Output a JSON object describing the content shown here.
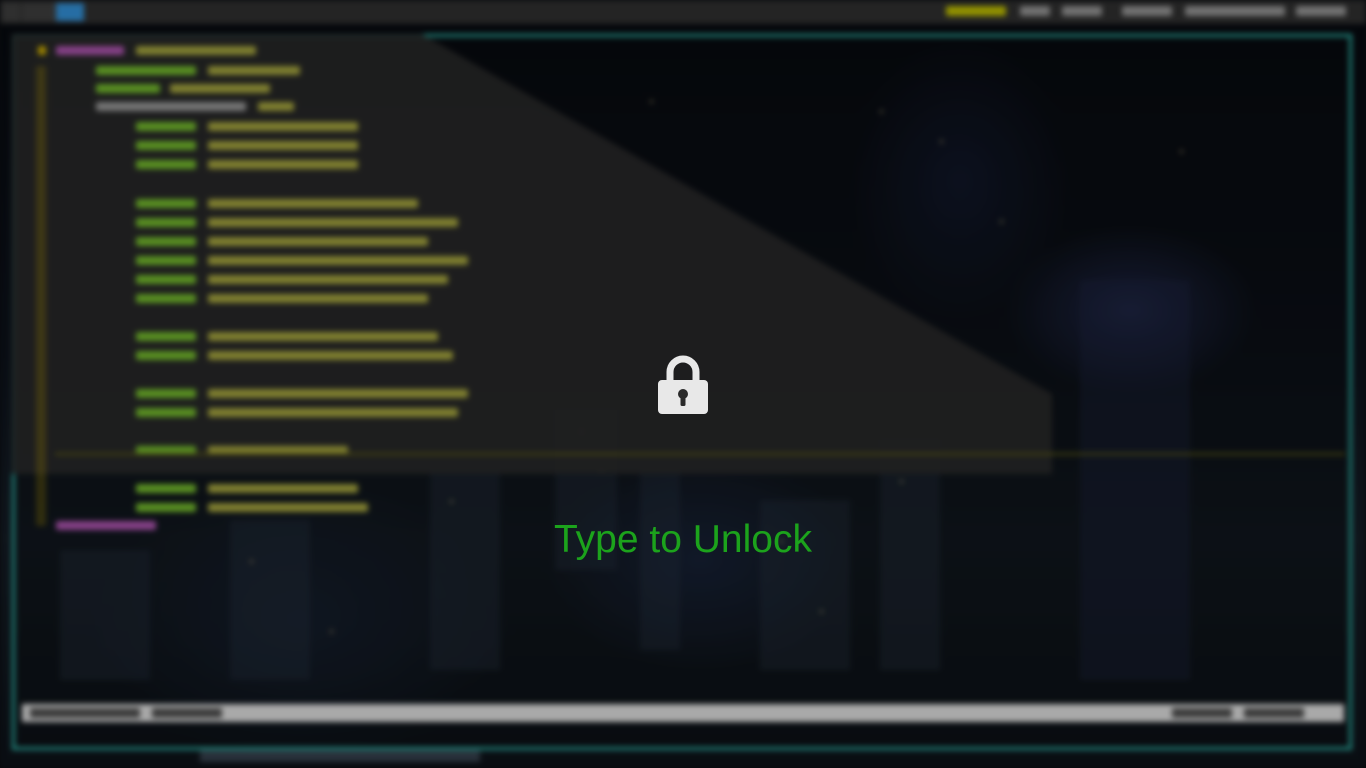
{
  "lock_screen": {
    "icon": "padlock-icon",
    "message": "Type to Unlock",
    "message_color": "#1ca31c",
    "icon_color": "#e8e8e8"
  },
  "background": {
    "terminal_border_color": "#2aa79b",
    "top_bar_active_workspace_color": "#2f86c8",
    "blurred": true
  }
}
